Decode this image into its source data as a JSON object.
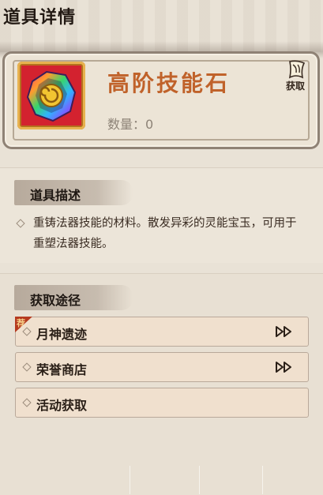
{
  "page": {
    "title": "道具详情"
  },
  "item": {
    "name": "高阶技能石",
    "quantity_label": "数量：",
    "quantity_value": "0",
    "obtain_button_label": "获取",
    "icon": "rainbow-gem-icon"
  },
  "description": {
    "header": "道具描述",
    "text": "重铸法器技能的材料。散发异彩的灵能宝玉，可用于重塑法器技能。"
  },
  "acquisition": {
    "header": "获取途径",
    "recommend_badge": "荐",
    "routes": [
      {
        "label": "月神遗迹",
        "icon": "double-arrow-icon"
      },
      {
        "label": "荣誉商店",
        "icon": "double-arrow-icon"
      },
      {
        "label": "活动获取"
      }
    ]
  },
  "colors": {
    "item_name": "#c0622a",
    "panel": "#ece5d9",
    "row": "#f0e0ce"
  }
}
